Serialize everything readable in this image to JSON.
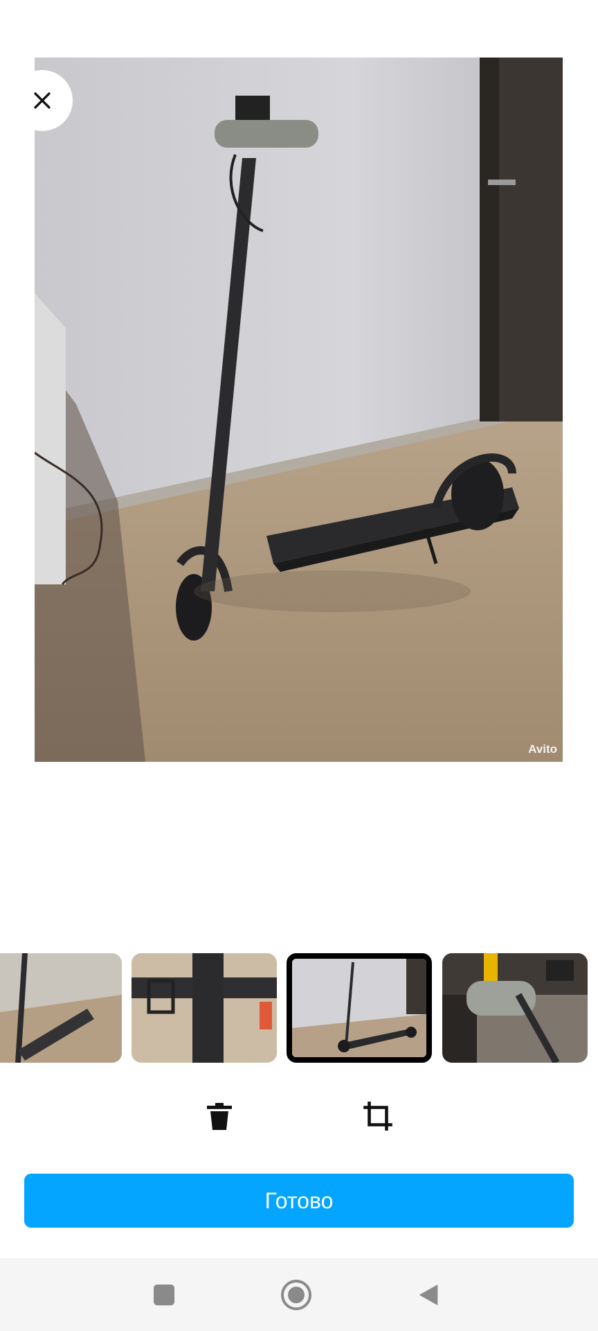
{
  "photo": {
    "watermark": "Avito"
  },
  "footer": {
    "done_label": "Готово"
  },
  "icons": {
    "close": "close-icon",
    "delete": "trash-icon",
    "crop": "crop-icon",
    "recents": "square-icon",
    "home": "home-circle-icon",
    "back": "back-triangle-icon"
  },
  "colors": {
    "accent": "#04a5ff",
    "nav_background": "#f5f5f5",
    "selected_border": "#000000"
  },
  "thumbnails": {
    "count": 4,
    "selected_index": 2
  }
}
